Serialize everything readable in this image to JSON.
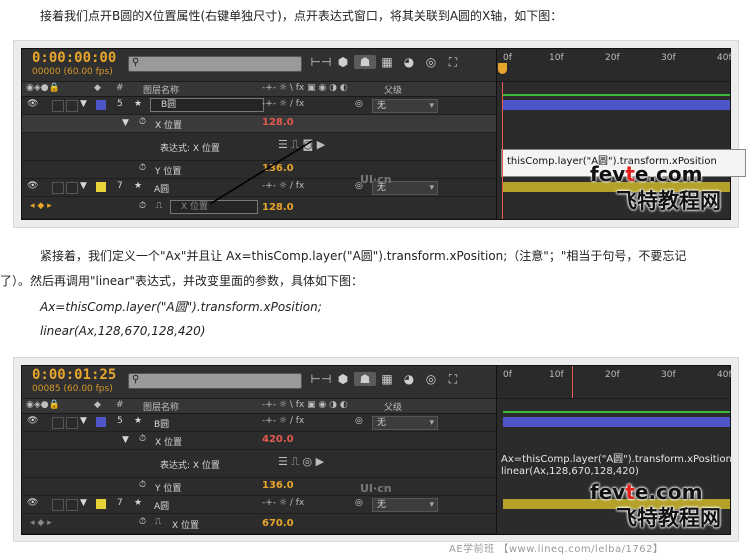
{
  "text": {
    "intro": "接着我们点开B圆的X位置属性(右键单独尺寸)，点开表达式窗口，将其关联到A圆的X轴，如下图：",
    "para2_line1": "紧接着，我们定义一个\"Ax\"并且让 Ax=thisComp.layer(\"A圆\").transform.xPosition;（注意\"；\"相当于句号，不要忘记",
    "para2_line2": "了）。然后再调用\"linear\"表达式，并改变里面的参数，具体如下图：",
    "code1": "Ax=thisComp.layer(\"A圆\").transform.xPosition;",
    "code2": "linear(Ax,128,670,128,420)"
  },
  "colors": {
    "accent": "#e7a52c",
    "red": "#e05a4e",
    "blue_layer": "#4d55c8",
    "yellow_layer": "#e8d23a",
    "watermark_red": "#e3221b"
  },
  "shot1": {
    "timecode": "0:00:00:00",
    "fps": "00000 (60.00 fps)",
    "search_icon": "search-icon",
    "ruler": [
      "0f",
      "10f",
      "20f",
      "30f",
      "40f"
    ],
    "headers": {
      "name": "图层名称",
      "parent": "父级"
    },
    "layer_b": {
      "num": "5",
      "name": "B圆",
      "parent": "无"
    },
    "x_position": {
      "label": "X 位置",
      "value": "128.0"
    },
    "expression_label": "表达式: X 位置",
    "y_position": {
      "label": "Y 位置",
      "value": "136.0"
    },
    "layer_a": {
      "num": "7",
      "name": "A圆",
      "parent": "无"
    },
    "a_x_position": {
      "label": "X 位置",
      "value": "128.0"
    },
    "expression_text": "thisComp.layer(\"A圆\").transform.xPosition"
  },
  "shot2": {
    "timecode": "0:00:01:25",
    "fps": "00085 (60.00 fps)",
    "ruler": [
      "0f",
      "10f",
      "20f",
      "30f",
      "40f"
    ],
    "headers": {
      "name": "图层名称",
      "parent": "父级"
    },
    "layer_b": {
      "num": "5",
      "name": "B圆",
      "parent": "无"
    },
    "x_position": {
      "label": "X 位置",
      "value": "420.0"
    },
    "expression_label": "表达式: X 位置",
    "y_position": {
      "label": "Y 位置",
      "value": "136.0"
    },
    "layer_a": {
      "num": "7",
      "name": "A圆",
      "parent": "无"
    },
    "a_x_position": {
      "label": "X 位置",
      "value": "670.0"
    },
    "expression_line1": "Ax=thisComp.layer(\"A圆\").transform.xPosition;",
    "expression_line2": "linear(Ax,128,670,128,420)"
  },
  "watermark": {
    "fevte_pre": "fev",
    "fevte_mid": "t",
    "fevte_post": "e.com",
    "cn": "飞特教程网",
    "ui": "UI·cn"
  },
  "footer": "AE学前班 【www.lineq.com/lelba/1762】"
}
